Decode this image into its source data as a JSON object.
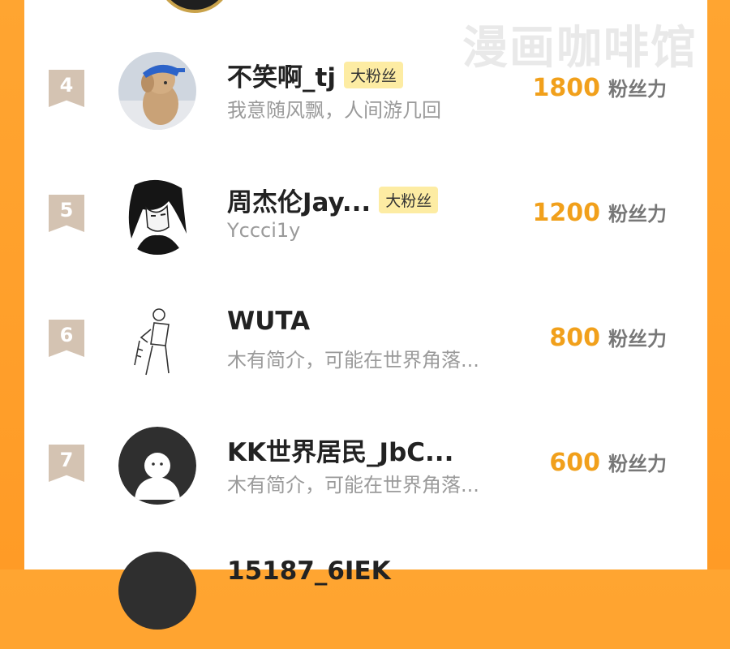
{
  "watermark": "漫画咖啡馆",
  "fans": [
    {
      "rank": "4",
      "name": "不笑啊_tj",
      "badge": "大粉丝",
      "bio": "我意随风飘，人间游几回",
      "score": "1800",
      "unit": "粉丝力",
      "avatar": "plush-dog-avatar"
    },
    {
      "rank": "5",
      "name": "周杰伦Jay...",
      "badge": "大粉丝",
      "bio": "Yccci1y",
      "score": "1200",
      "unit": "粉丝力",
      "avatar": "sketch-portrait-avatar"
    },
    {
      "rank": "6",
      "name": "WUTA",
      "badge": "",
      "bio": "木有简介，可能在世界角落...",
      "score": "800",
      "unit": "粉丝力",
      "avatar": "line-drawing-avatar"
    },
    {
      "rank": "7",
      "name": "KK世界居民_JbC...",
      "badge": "",
      "bio": "木有简介，可能在世界角落...",
      "score": "600",
      "unit": "粉丝力",
      "avatar": "default-user-avatar"
    },
    {
      "rank": "",
      "name": "15187_6IEK",
      "badge": "",
      "bio": "",
      "score": "",
      "unit": "",
      "avatar": "dark-avatar"
    }
  ]
}
